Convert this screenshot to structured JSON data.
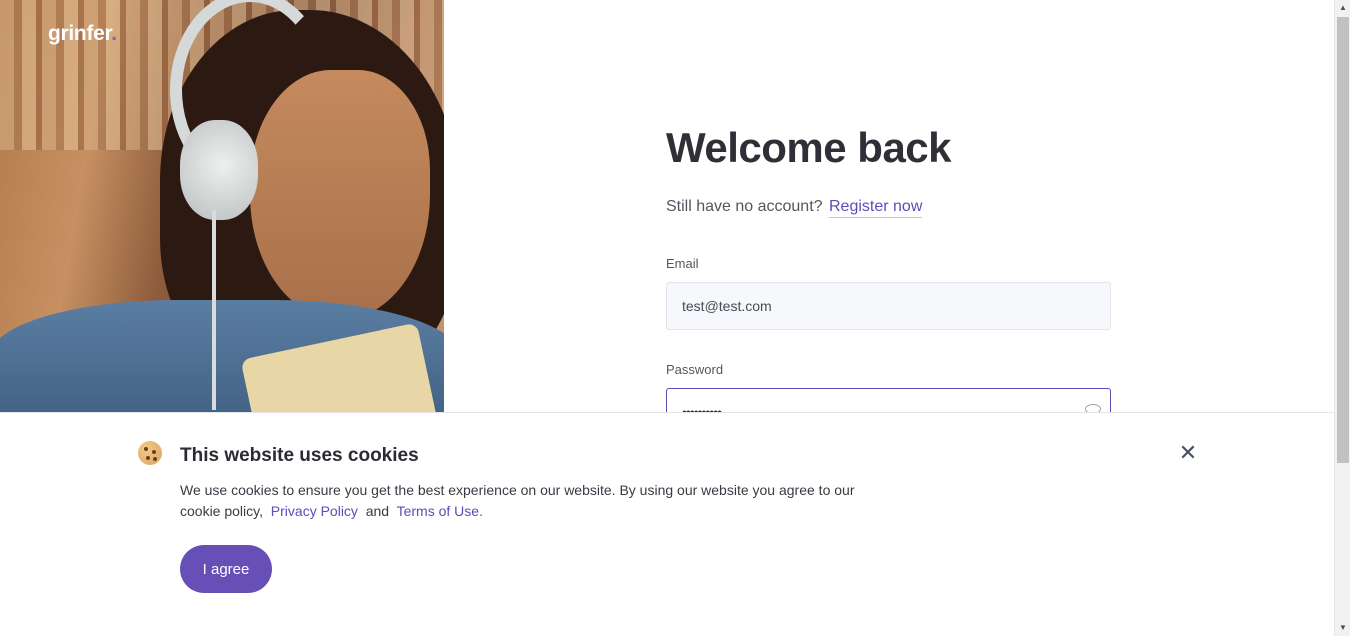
{
  "brand": {
    "name": "grinfer",
    "dot": "."
  },
  "login": {
    "title": "Welcome back",
    "subtitle": "Still have no account?",
    "register_link": "Register now",
    "email_label": "Email",
    "email_value": "test@test.com",
    "password_label": "Password",
    "password_value": "••••••••••"
  },
  "cookie_banner": {
    "title": "This website uses cookies",
    "text_part1": "We use cookies to ensure you get the best experience on our website. By using our website you agree to our cookie policy,",
    "privacy_link": "Privacy Policy",
    "and_text": "and",
    "terms_link": "Terms of Use",
    "period": ".",
    "agree_label": "I agree",
    "close_symbol": "✕"
  },
  "colors": {
    "accent": "#6650b8",
    "link": "#5f4bb6"
  },
  "icons": [
    "cookie-icon",
    "close-icon",
    "eye-icon"
  ]
}
